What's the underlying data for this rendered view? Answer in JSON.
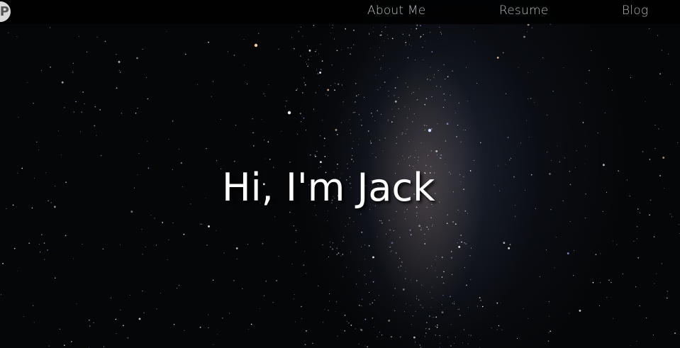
{
  "nav": {
    "logo_letter": "P",
    "links": [
      {
        "label": "About Me"
      },
      {
        "label": "Resume"
      },
      {
        "label": "Blog"
      }
    ]
  },
  "hero": {
    "title": "Hi, I'm Jack",
    "background": "starry-night-sky-milky-way"
  },
  "colors": {
    "nav_bg": "#000000",
    "nav_text": "#b8b8b8",
    "hero_text": "#ffffff",
    "logo_bg": "#d9d9d9"
  }
}
